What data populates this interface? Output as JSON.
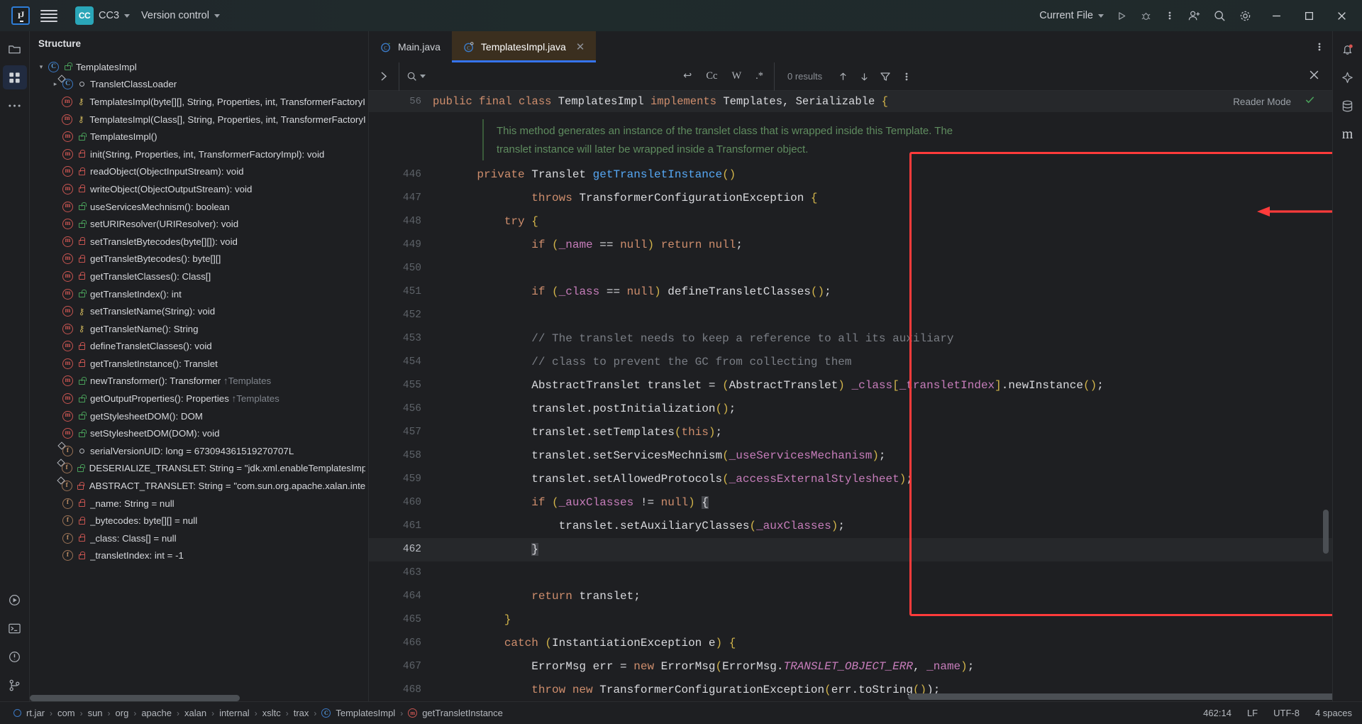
{
  "titlebar": {
    "logo": "IJ",
    "menu_icon": "hamburger-icon",
    "project_badge": "CC",
    "project_name": "CC3",
    "vcs_label": "Version control",
    "run_config": "Current File",
    "icons": [
      "run-icon",
      "debug-icon",
      "more-actions-icon",
      "add-user-icon",
      "search-icon",
      "settings-icon"
    ],
    "window": {
      "minimize": "—",
      "maximize": "❐",
      "close": "✕"
    }
  },
  "left_rail": {
    "items": [
      {
        "name": "project-icon",
        "glyph": "folder"
      },
      {
        "name": "structure-icon",
        "glyph": "grid"
      },
      {
        "name": "more-tool-windows-icon",
        "glyph": "dots"
      },
      {
        "name": "run-tool-window-icon",
        "glyph": "play"
      },
      {
        "name": "terminal-icon",
        "glyph": "terminal"
      },
      {
        "name": "problems-icon",
        "glyph": "warning"
      },
      {
        "name": "version-control-icon",
        "glyph": "branch"
      }
    ]
  },
  "right_rail": {
    "items": [
      {
        "name": "notifications-icon",
        "glyph": "bell"
      },
      {
        "name": "ai-assistant-icon",
        "glyph": "ai"
      },
      {
        "name": "database-icon",
        "glyph": "db"
      },
      {
        "name": "maven-icon",
        "glyph": "m"
      }
    ]
  },
  "structure": {
    "title": "Structure",
    "rows": [
      {
        "indent": 0,
        "arrow": "expanded",
        "icon": "class",
        "vis": "unlocked-green",
        "label": "TemplatesImpl"
      },
      {
        "indent": 1,
        "arrow": "collapsed",
        "icon": "class-static",
        "vis": "circle",
        "label": "TransletClassLoader"
      },
      {
        "indent": 1,
        "arrow": "",
        "icon": "method",
        "vis": "key",
        "label": "TemplatesImpl(byte[][], String, Properties, int, TransformerFactoryImp"
      },
      {
        "indent": 1,
        "arrow": "",
        "icon": "method",
        "vis": "key",
        "label": "TemplatesImpl(Class[], String, Properties, int, TransformerFactoryImp"
      },
      {
        "indent": 1,
        "arrow": "",
        "icon": "method",
        "vis": "unlocked-green",
        "label": "TemplatesImpl()"
      },
      {
        "indent": 1,
        "arrow": "",
        "icon": "method",
        "vis": "locked-red",
        "label": "init(String, Properties, int, TransformerFactoryImpl): void"
      },
      {
        "indent": 1,
        "arrow": "",
        "icon": "method",
        "vis": "locked-red",
        "label": "readObject(ObjectInputStream): void"
      },
      {
        "indent": 1,
        "arrow": "",
        "icon": "method",
        "vis": "locked-red",
        "label": "writeObject(ObjectOutputStream): void"
      },
      {
        "indent": 1,
        "arrow": "",
        "icon": "method",
        "vis": "unlocked-green",
        "label": "useServicesMechnism(): boolean"
      },
      {
        "indent": 1,
        "arrow": "",
        "icon": "method",
        "vis": "unlocked-green",
        "label": "setURIResolver(URIResolver): void"
      },
      {
        "indent": 1,
        "arrow": "",
        "icon": "method",
        "vis": "locked-red",
        "label": "setTransletBytecodes(byte[][]): void"
      },
      {
        "indent": 1,
        "arrow": "",
        "icon": "method",
        "vis": "locked-red",
        "label": "getTransletBytecodes(): byte[][]"
      },
      {
        "indent": 1,
        "arrow": "",
        "icon": "method",
        "vis": "locked-red",
        "label": "getTransletClasses(): Class[]"
      },
      {
        "indent": 1,
        "arrow": "",
        "icon": "method",
        "vis": "unlocked-green",
        "label": "getTransletIndex(): int"
      },
      {
        "indent": 1,
        "arrow": "",
        "icon": "method",
        "vis": "key",
        "label": "setTransletName(String): void"
      },
      {
        "indent": 1,
        "arrow": "",
        "icon": "method",
        "vis": "key",
        "label": "getTransletName(): String"
      },
      {
        "indent": 1,
        "arrow": "",
        "icon": "method",
        "vis": "locked-red",
        "label": "defineTransletClasses(): void"
      },
      {
        "indent": 1,
        "arrow": "",
        "icon": "method",
        "vis": "locked-red",
        "label": "getTransletInstance(): Translet"
      },
      {
        "indent": 1,
        "arrow": "",
        "icon": "method",
        "vis": "unlocked-green",
        "label": "newTransformer(): Transformer",
        "sup": "↑Templates"
      },
      {
        "indent": 1,
        "arrow": "",
        "icon": "method",
        "vis": "unlocked-green",
        "label": "getOutputProperties(): Properties",
        "sup": "↑Templates"
      },
      {
        "indent": 1,
        "arrow": "",
        "icon": "method",
        "vis": "unlocked-green",
        "label": "getStylesheetDOM(): DOM"
      },
      {
        "indent": 1,
        "arrow": "",
        "icon": "method",
        "vis": "unlocked-green",
        "label": "setStylesheetDOM(DOM): void"
      },
      {
        "indent": 1,
        "arrow": "",
        "icon": "field-static",
        "vis": "circle",
        "label": "serialVersionUID: long = 673094361519270707L"
      },
      {
        "indent": 1,
        "arrow": "",
        "icon": "field-static",
        "vis": "unlocked-green",
        "label": "DESERIALIZE_TRANSLET: String = \"jdk.xml.enableTemplatesImplDese"
      },
      {
        "indent": 1,
        "arrow": "",
        "icon": "field-static",
        "vis": "locked-red",
        "label": "ABSTRACT_TRANSLET: String = \"com.sun.org.apache.xalan.internal.x"
      },
      {
        "indent": 1,
        "arrow": "",
        "icon": "field",
        "vis": "locked-red",
        "label": "_name: String = null"
      },
      {
        "indent": 1,
        "arrow": "",
        "icon": "field",
        "vis": "locked-red",
        "label": "_bytecodes: byte[][] = null"
      },
      {
        "indent": 1,
        "arrow": "",
        "icon": "field",
        "vis": "locked-red",
        "label": "_class: Class[] = null"
      },
      {
        "indent": 1,
        "arrow": "",
        "icon": "field",
        "vis": "locked-red",
        "label": "_transletIndex: int = -1"
      }
    ]
  },
  "editor": {
    "tabs": [
      {
        "label": "Main.java",
        "icon": "java-class-icon",
        "active": false,
        "closable": false
      },
      {
        "label": "TemplatesImpl.java",
        "icon": "java-class-icon",
        "active": true,
        "closable": true,
        "close_glyph": "✕"
      }
    ],
    "tab_options_icon": "more-options-icon"
  },
  "findbar": {
    "expand_icon": "chevron-right-icon",
    "search_icon": "search-dropdown-icon",
    "query": "",
    "placeholder": "",
    "toggles": [
      {
        "name": "regex-newline-toggle",
        "label": "↩"
      },
      {
        "name": "match-case-toggle",
        "label": "Cc"
      },
      {
        "name": "words-toggle",
        "label": "W"
      },
      {
        "name": "regex-toggle",
        "label": ".*"
      }
    ],
    "results": "0 results",
    "prev_icon": "arrow-up-icon",
    "next_icon": "arrow-down-icon",
    "filter_icon": "filter-icon",
    "more_icon": "more-options-icon",
    "close_icon": "close-icon"
  },
  "sticky_header": {
    "line_no": "56",
    "reader_mode": "Reader Mode",
    "check_icon": "checkmark-icon",
    "tokens": [
      {
        "t": "public ",
        "c": "kw"
      },
      {
        "t": "final ",
        "c": "kw"
      },
      {
        "t": "class ",
        "c": "kw"
      },
      {
        "t": "TemplatesImpl ",
        "c": "nm"
      },
      {
        "t": "implements ",
        "c": "kw"
      },
      {
        "t": "Templates, Serializable ",
        "c": "nm"
      },
      {
        "t": "{",
        "c": "par"
      }
    ]
  },
  "doc_comment": {
    "line1": "This method generates an instance of the translet class that is wrapped inside this Template. The",
    "line2": "translet instance will later be wrapped inside a Transformer object."
  },
  "code": {
    "current_line": 462,
    "lines": [
      {
        "n": "446",
        "tokens": [
          {
            "t": "    ",
            "c": "nm"
          },
          {
            "t": "private ",
            "c": "kw"
          },
          {
            "t": "Translet ",
            "c": "nm"
          },
          {
            "t": "getTransletInstance",
            "c": "mth"
          },
          {
            "t": "()",
            "c": "par"
          }
        ]
      },
      {
        "n": "447",
        "tokens": [
          {
            "t": "            ",
            "c": "nm"
          },
          {
            "t": "throws ",
            "c": "kw"
          },
          {
            "t": "TransformerConfigurationException ",
            "c": "nm"
          },
          {
            "t": "{",
            "c": "par"
          }
        ]
      },
      {
        "n": "448",
        "tokens": [
          {
            "t": "        ",
            "c": "nm"
          },
          {
            "t": "try ",
            "c": "kw"
          },
          {
            "t": "{",
            "c": "par"
          }
        ]
      },
      {
        "n": "449",
        "tokens": [
          {
            "t": "            ",
            "c": "nm"
          },
          {
            "t": "if ",
            "c": "kw"
          },
          {
            "t": "(",
            "c": "par"
          },
          {
            "t": "_name",
            "c": "fld"
          },
          {
            "t": " == ",
            "c": "nm"
          },
          {
            "t": "null",
            "c": "kw"
          },
          {
            "t": ")",
            "c": "par"
          },
          {
            "t": " ",
            "c": "nm"
          },
          {
            "t": "return ",
            "c": "kw"
          },
          {
            "t": "null",
            "c": "kw"
          },
          {
            "t": ";",
            "c": "nm"
          }
        ]
      },
      {
        "n": "450",
        "tokens": []
      },
      {
        "n": "451",
        "tokens": [
          {
            "t": "            ",
            "c": "nm"
          },
          {
            "t": "if ",
            "c": "kw"
          },
          {
            "t": "(",
            "c": "par"
          },
          {
            "t": "_class",
            "c": "fld"
          },
          {
            "t": " == ",
            "c": "nm"
          },
          {
            "t": "null",
            "c": "kw"
          },
          {
            "t": ")",
            "c": "par"
          },
          {
            "t": " defineTransletClasses",
            "c": "nm"
          },
          {
            "t": "()",
            "c": "par"
          },
          {
            "t": ";",
            "c": "nm"
          }
        ]
      },
      {
        "n": "452",
        "tokens": []
      },
      {
        "n": "453",
        "tokens": [
          {
            "t": "            // The translet needs to keep a reference to all its auxiliary",
            "c": "cm"
          }
        ]
      },
      {
        "n": "454",
        "tokens": [
          {
            "t": "            // class to prevent the GC from collecting them",
            "c": "cm"
          }
        ]
      },
      {
        "n": "455",
        "tokens": [
          {
            "t": "            AbstractTranslet translet = ",
            "c": "nm"
          },
          {
            "t": "(",
            "c": "par"
          },
          {
            "t": "AbstractTranslet",
            "c": "nm"
          },
          {
            "t": ")",
            "c": "par"
          },
          {
            "t": " ",
            "c": "nm"
          },
          {
            "t": "_class",
            "c": "fld"
          },
          {
            "t": "[",
            "c": "par"
          },
          {
            "t": "_transletIndex",
            "c": "fld"
          },
          {
            "t": "]",
            "c": "par"
          },
          {
            "t": ".newInstance",
            "c": "nm"
          },
          {
            "t": "()",
            "c": "par"
          },
          {
            "t": ";",
            "c": "nm"
          }
        ]
      },
      {
        "n": "456",
        "tokens": [
          {
            "t": "            translet.postInitialization",
            "c": "nm"
          },
          {
            "t": "()",
            "c": "par"
          },
          {
            "t": ";",
            "c": "nm"
          }
        ]
      },
      {
        "n": "457",
        "tokens": [
          {
            "t": "            translet.setTemplates",
            "c": "nm"
          },
          {
            "t": "(",
            "c": "par"
          },
          {
            "t": "this",
            "c": "kw"
          },
          {
            "t": ")",
            "c": "par"
          },
          {
            "t": ";",
            "c": "nm"
          }
        ]
      },
      {
        "n": "458",
        "tokens": [
          {
            "t": "            translet.setServicesMechnism",
            "c": "nm"
          },
          {
            "t": "(",
            "c": "par"
          },
          {
            "t": "_useServicesMechanism",
            "c": "fld"
          },
          {
            "t": ")",
            "c": "par"
          },
          {
            "t": ";",
            "c": "nm"
          }
        ]
      },
      {
        "n": "459",
        "tokens": [
          {
            "t": "            translet.setAllowedProtocols",
            "c": "nm"
          },
          {
            "t": "(",
            "c": "par"
          },
          {
            "t": "_accessExternalStylesheet",
            "c": "fld"
          },
          {
            "t": ")",
            "c": "par"
          },
          {
            "t": ";",
            "c": "nm"
          }
        ]
      },
      {
        "n": "460",
        "tokens": [
          {
            "t": "            ",
            "c": "nm"
          },
          {
            "t": "if ",
            "c": "kw"
          },
          {
            "t": "(",
            "c": "par"
          },
          {
            "t": "_auxClasses",
            "c": "fld"
          },
          {
            "t": " != ",
            "c": "nm"
          },
          {
            "t": "null",
            "c": "kw"
          },
          {
            "t": ")",
            "c": "par"
          },
          {
            "t": " ",
            "c": "nm"
          },
          {
            "t": "{",
            "c": "sel"
          }
        ]
      },
      {
        "n": "461",
        "tokens": [
          {
            "t": "                translet.setAuxiliaryClasses",
            "c": "nm"
          },
          {
            "t": "(",
            "c": "par"
          },
          {
            "t": "_auxClasses",
            "c": "fld"
          },
          {
            "t": ")",
            "c": "par"
          },
          {
            "t": ";",
            "c": "nm"
          }
        ]
      },
      {
        "n": "462",
        "tokens": [
          {
            "t": "            ",
            "c": "nm"
          },
          {
            "t": "}",
            "c": "sel"
          }
        ]
      },
      {
        "n": "463",
        "tokens": []
      },
      {
        "n": "464",
        "tokens": [
          {
            "t": "            ",
            "c": "nm"
          },
          {
            "t": "return ",
            "c": "kw"
          },
          {
            "t": "translet",
            "c": "nm"
          },
          {
            "t": ";",
            "c": "nm"
          }
        ]
      },
      {
        "n": "465",
        "tokens": [
          {
            "t": "        ",
            "c": "nm"
          },
          {
            "t": "}",
            "c": "par"
          }
        ]
      },
      {
        "n": "466",
        "tokens": [
          {
            "t": "        ",
            "c": "nm"
          },
          {
            "t": "catch ",
            "c": "kw"
          },
          {
            "t": "(",
            "c": "par"
          },
          {
            "t": "InstantiationException e",
            "c": "nm"
          },
          {
            "t": ")",
            "c": "par"
          },
          {
            "t": " ",
            "c": "nm"
          },
          {
            "t": "{",
            "c": "par"
          }
        ]
      },
      {
        "n": "467",
        "tokens": [
          {
            "t": "            ErrorMsg err = ",
            "c": "nm"
          },
          {
            "t": "new ",
            "c": "kw"
          },
          {
            "t": "ErrorMsg",
            "c": "nm"
          },
          {
            "t": "(",
            "c": "par"
          },
          {
            "t": "ErrorMsg.",
            "c": "nm"
          },
          {
            "t": "TRANSLET_OBJECT_ERR",
            "c": "it"
          },
          {
            "t": ", ",
            "c": "nm"
          },
          {
            "t": "_name",
            "c": "fld"
          },
          {
            "t": ")",
            "c": "par"
          },
          {
            "t": ";",
            "c": "nm"
          }
        ]
      },
      {
        "n": "468",
        "tokens": [
          {
            "t": "            ",
            "c": "nm"
          },
          {
            "t": "throw new ",
            "c": "kw"
          },
          {
            "t": "TransformerConfigurationException",
            "c": "nm"
          },
          {
            "t": "(",
            "c": "par"
          },
          {
            "t": "err.toString",
            "c": "nm"
          },
          {
            "t": "()",
            "c": "par"
          },
          {
            "t": ");",
            "c": "nm"
          }
        ]
      }
    ]
  },
  "annotations": {
    "box": {
      "name": "red-highlight-box"
    },
    "arrows": [
      {
        "name": "red-arrow-1",
        "points_to": "line-449"
      },
      {
        "name": "red-arrow-2",
        "points_to": "line-451"
      },
      {
        "name": "red-arrow-3",
        "points_to": "line-454"
      }
    ]
  },
  "status_bar": {
    "breadcrumbs": [
      {
        "label": "rt.jar",
        "icon": "jar-icon"
      },
      {
        "label": "com",
        "icon": ""
      },
      {
        "label": "sun",
        "icon": ""
      },
      {
        "label": "org",
        "icon": ""
      },
      {
        "label": "apache",
        "icon": ""
      },
      {
        "label": "xalan",
        "icon": ""
      },
      {
        "label": "internal",
        "icon": ""
      },
      {
        "label": "xsltc",
        "icon": ""
      },
      {
        "label": "trax",
        "icon": ""
      },
      {
        "label": "TemplatesImpl",
        "icon": "class-icon"
      },
      {
        "label": "getTransletInstance",
        "icon": "method-icon"
      }
    ],
    "separator": "›",
    "caret": "462:14",
    "line_sep": "LF",
    "encoding": "UTF-8",
    "indent": "4 spaces"
  }
}
